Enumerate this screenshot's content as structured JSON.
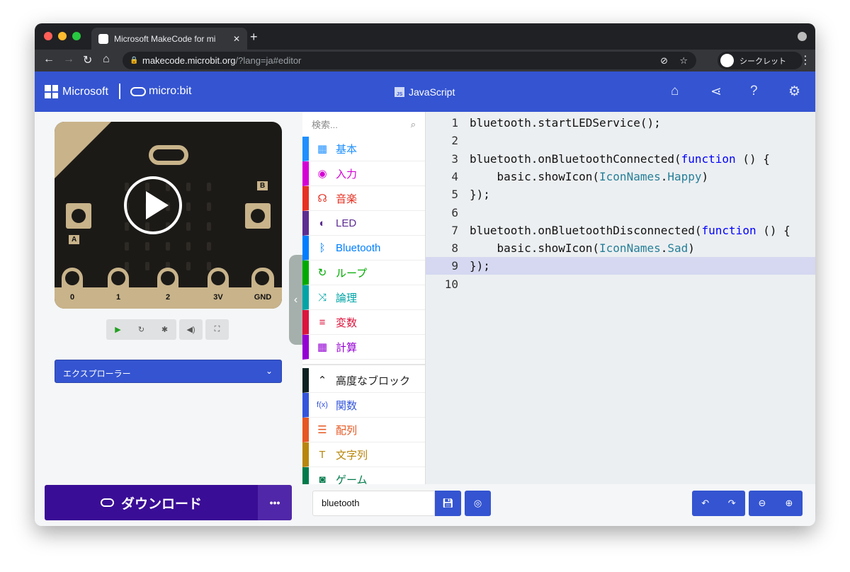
{
  "browser": {
    "tab_title": "Microsoft MakeCode for mi",
    "url_host": "makecode.microbit.org",
    "url_path": "/?lang=ja#editor",
    "profile": "シークレット"
  },
  "header": {
    "brand": "Microsoft",
    "product": "micro:bit",
    "mode": "JavaScript",
    "mode_badge": "JS"
  },
  "simulator": {
    "pins": [
      "0",
      "1",
      "2",
      "3V",
      "GND"
    ],
    "button_a": "A",
    "button_b": "B"
  },
  "explorer": {
    "label": "エクスプローラー"
  },
  "toolbox": {
    "search_placeholder": "検索...",
    "categories": [
      {
        "label": "基本",
        "color": "#1e90ff",
        "icon": "grid-icon",
        "glyph": "▦"
      },
      {
        "label": "入力",
        "color": "#d400d4",
        "icon": "target-icon",
        "glyph": "◉"
      },
      {
        "label": "音楽",
        "color": "#e63022",
        "icon": "headphones-icon",
        "glyph": "☊"
      },
      {
        "label": "LED",
        "color": "#5c2d91",
        "icon": "toggle-icon",
        "glyph": "◐"
      },
      {
        "label": "Bluetooth",
        "color": "#007eff",
        "icon": "bluetooth-icon",
        "glyph": "ᛒ"
      },
      {
        "label": "ループ",
        "color": "#00aa00",
        "icon": "loop-icon",
        "glyph": "↻"
      },
      {
        "label": "論理",
        "color": "#00a4a6",
        "icon": "shuffle-icon",
        "glyph": "⤨"
      },
      {
        "label": "変数",
        "color": "#dc143c",
        "icon": "lines-icon",
        "glyph": "≡"
      },
      {
        "label": "計算",
        "color": "#9400d3",
        "icon": "calculator-icon",
        "glyph": "▦"
      }
    ],
    "advanced": [
      {
        "label": "高度なブロック",
        "color": "#0f2222",
        "icon": "chevron-up-icon",
        "glyph": "⌃"
      },
      {
        "label": "関数",
        "color": "#3455db",
        "icon": "function-icon",
        "glyph": "f(x)"
      },
      {
        "label": "配列",
        "color": "#e65722",
        "icon": "list-icon",
        "glyph": "☰"
      },
      {
        "label": "文字列",
        "color": "#b8860b",
        "icon": "text-icon",
        "glyph": "T"
      },
      {
        "label": "ゲーム",
        "color": "#007a4b",
        "icon": "gamepad-icon",
        "glyph": "◙"
      }
    ]
  },
  "editor": {
    "current_line": 9,
    "lines": [
      [
        {
          "t": "bluetooth.startLEDService();"
        }
      ],
      [],
      [
        {
          "t": "bluetooth.onBluetoothConnected("
        },
        {
          "t": "function",
          "c": "kw"
        },
        {
          "t": " () {"
        }
      ],
      [
        {
          "t": "    basic.showIcon("
        },
        {
          "t": "IconNames",
          "c": "ty"
        },
        {
          "t": "."
        },
        {
          "t": "Happy",
          "c": "ty"
        },
        {
          "t": ")"
        }
      ],
      [
        {
          "t": "});"
        }
      ],
      [],
      [
        {
          "t": "bluetooth.onBluetoothDisconnected("
        },
        {
          "t": "function",
          "c": "kw"
        },
        {
          "t": " () {"
        }
      ],
      [
        {
          "t": "    basic.showIcon("
        },
        {
          "t": "IconNames",
          "c": "ty"
        },
        {
          "t": "."
        },
        {
          "t": "Sad",
          "c": "ty"
        },
        {
          "t": ")"
        }
      ],
      [
        {
          "t": "});"
        }
      ],
      []
    ]
  },
  "bottom": {
    "download": "ダウンロード",
    "more": "•••",
    "project_name": "bluetooth"
  }
}
